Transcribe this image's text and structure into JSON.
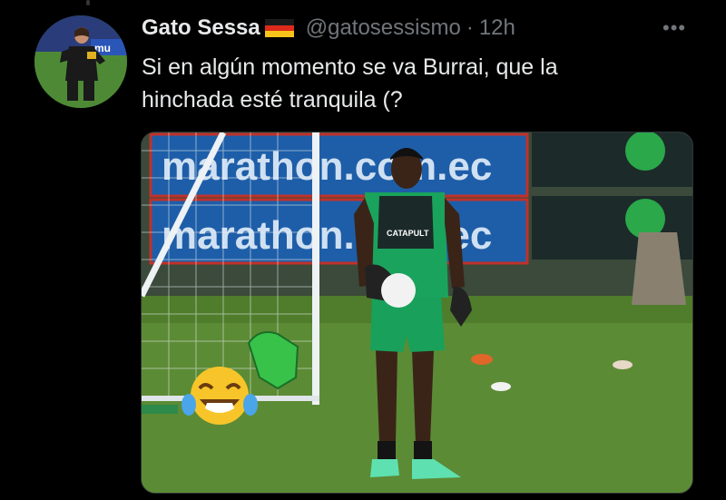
{
  "tweet": {
    "display_name": "Gato Sessa",
    "flag_icon": "germany-flag-icon",
    "handle": "@gatosessismo",
    "separator": "·",
    "time": "12h",
    "more_icon": "more-horizontal-icon",
    "more_glyph": "•••",
    "text_line1": "Si en algún momento se va Burrai, que la",
    "text_line2": "hinchada esté tranquila (?"
  },
  "media": {
    "banner_text_1": "marathon.com.ec",
    "banner_text_2": "marathon.com.ec",
    "vest_text": "CATAPULT",
    "emoji": "face-with-tears-of-joy",
    "colors": {
      "banner": "#1d5aa0",
      "grass": "#5a8a34",
      "kit": "#19a05a"
    }
  },
  "avatar": {
    "badge_text": "mu"
  }
}
